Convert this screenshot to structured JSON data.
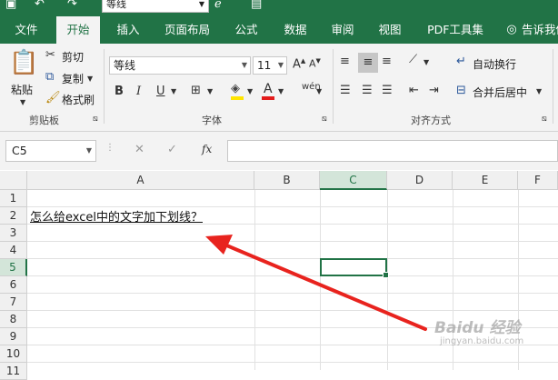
{
  "qat": {
    "font_box": "等线"
  },
  "tabs": [
    "文件",
    "开始",
    "插入",
    "页面布局",
    "公式",
    "数据",
    "审阅",
    "视图",
    "PDF工具集"
  ],
  "tell_me": "告诉我你",
  "clipboard": {
    "paste": "粘贴",
    "cut": "剪切",
    "copy": "复制",
    "format_painter": "格式刷",
    "label": "剪贴板"
  },
  "font": {
    "name": "等线",
    "size": "11",
    "bold": "B",
    "italic": "I",
    "underline": "U",
    "phonetic": "wén",
    "label": "字体"
  },
  "alignment": {
    "wrap_text": "自动换行",
    "merge_center": "合并后居中",
    "label": "对齐方式"
  },
  "formula_bar": {
    "name_box": "C5",
    "fx": "fx",
    "value": ""
  },
  "grid": {
    "columns": [
      "A",
      "B",
      "C",
      "D",
      "E",
      "F"
    ],
    "rows": [
      "1",
      "2",
      "3",
      "4",
      "5",
      "6",
      "7",
      "8",
      "9",
      "10",
      "11"
    ],
    "selected_cell": "C5",
    "cell_A2": "怎么给excel中的文字加下划线？"
  },
  "colors": {
    "excel_green": "#217346",
    "arrow_red": "#e8231e",
    "font_color_red": "#e31b1b",
    "highlight_yellow": "#ffe500"
  },
  "watermark": {
    "brand": "Baidu 经验",
    "url": "jingyan.baidu.com"
  }
}
